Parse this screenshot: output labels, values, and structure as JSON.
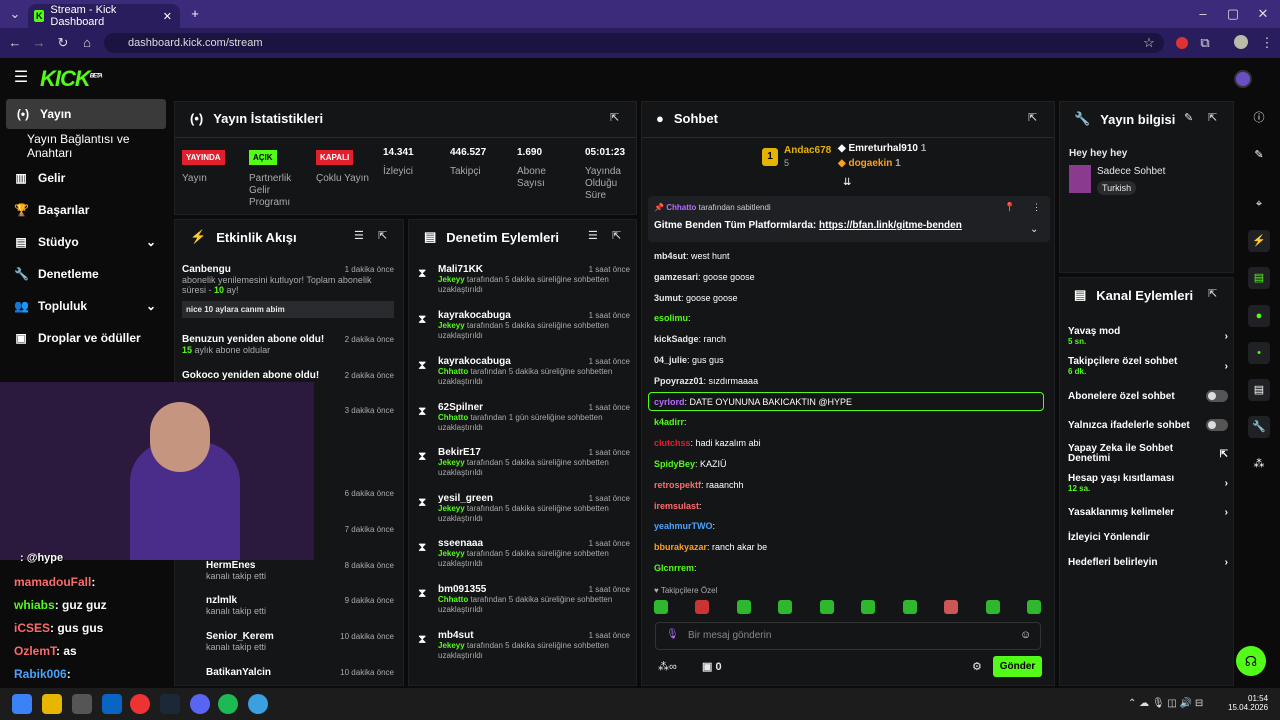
{
  "browser": {
    "tab_title": "Stream - Kick Dashboard",
    "url": "dashboard.kick.com/stream"
  },
  "header": {
    "logo": "KICK",
    "logo_sup": "BETA"
  },
  "nav": {
    "items": [
      {
        "label": "Yayın",
        "icon": "broadcast-icon"
      },
      {
        "label": "Yayın Bağlantısı ve Anahtarı"
      },
      {
        "label": "Gelir",
        "icon": "revenue-icon"
      },
      {
        "label": "Başarılar",
        "icon": "trophy-icon"
      },
      {
        "label": "Stüdyo",
        "icon": "studio-icon"
      },
      {
        "label": "Denetleme",
        "icon": "wrench-icon"
      },
      {
        "label": "Topluluk",
        "icon": "community-icon"
      },
      {
        "label": "Droplar ve ödüller",
        "icon": "gift-icon"
      }
    ]
  },
  "stats": {
    "title": "Yayın İstatistikleri",
    "tags": [
      {
        "text": "YAYINDA",
        "label": "Yayın",
        "color": "#e0202d"
      },
      {
        "text": "AÇIK",
        "label": "Partnerlik Gelir Programı",
        "color": "#53fc18"
      },
      {
        "text": "KAPALI",
        "label": "Çoklu Yayın",
        "color": "#e0202d"
      }
    ],
    "values": [
      {
        "value": "14.341",
        "label": "İzleyici"
      },
      {
        "value": "446.527",
        "label": "Takipçi"
      },
      {
        "value": "1.690",
        "label": "Abone Sayısı"
      },
      {
        "value": "05:01:23",
        "label": "Yayında Olduğu Süre"
      }
    ]
  },
  "activity": {
    "title": "Etkinlik Akışı",
    "items": [
      {
        "name": "Canbengu",
        "time": "1 dakika önce",
        "desc": "abonelik yenilemesini kutluyor! Toplam abonelik süresi - ",
        "months": "10",
        "suffix": " ay!",
        "msg": "nice 10 aylara canım abim"
      },
      {
        "name": "Benuzun yeniden abone oldu!",
        "time": "2 dakika önce",
        "months": "15",
        "desc": " aylık abone oldular"
      },
      {
        "name": "Gokoco yeniden abone oldu!",
        "time": "2 dakika önce"
      },
      {
        "name": "",
        "time": "3 dakika önce"
      },
      {
        "name": "e",
        "time": "3 dakika önce"
      },
      {
        "name": "du!",
        "time": "6 dakika önce"
      },
      {
        "name": "",
        "time": "7 dakika önce"
      },
      {
        "name": "HermEnes",
        "time": "8 dakika önce",
        "desc": "kanalı takip etti"
      },
      {
        "name": "nzlmlk",
        "time": "9 dakika önce",
        "desc": "kanalı takip etti"
      },
      {
        "name": "Senior_Kerem",
        "time": "10 dakika önce",
        "desc": "kanalı takip etti"
      },
      {
        "name": "BatikanYalcin",
        "time": "10 dakika önce"
      }
    ]
  },
  "moderation": {
    "title": "Denetim Eylemleri",
    "items": [
      {
        "name": "Mali71KK",
        "time": "1 saat önce",
        "by": "Jekeyy",
        "desc": " tarafından 5 dakika süreliğine sohbetten uzaklaştırıldı"
      },
      {
        "name": "kayrakocabuga",
        "time": "1 saat önce",
        "by": "Jekeyy",
        "desc": " tarafından 5 dakika süreliğine sohbetten uzaklaştırıldı"
      },
      {
        "name": "kayrakocabuga",
        "time": "1 saat önce",
        "by": "Chhatto",
        "desc": " tarafından 5 dakika süreliğine sohbetten uzaklaştırıldı"
      },
      {
        "name": "62Spilner",
        "time": "1 saat önce",
        "by": "Chhatto",
        "desc": " tarafından 1 gün süreliğine sohbetten uzaklaştırıldı"
      },
      {
        "name": "BekirE17",
        "time": "1 saat önce",
        "by": "Jekeyy",
        "desc": " tarafından 5 dakika süreliğine sohbetten uzaklaştırıldı"
      },
      {
        "name": "yesil_green",
        "time": "1 saat önce",
        "by": "Jekeyy",
        "desc": " tarafından 5 dakika süreliğine sohbetten uzaklaştırıldı"
      },
      {
        "name": "sseenaaa",
        "time": "1 saat önce",
        "by": "Jekeyy",
        "desc": " tarafından 5 dakika süreliğine sohbetten uzaklaştırıldı"
      },
      {
        "name": "bm091355",
        "time": "1 saat önce",
        "by": "Chhatto",
        "desc": " tarafından 5 dakika süreliğine sohbetten uzaklaştırıldı"
      },
      {
        "name": "mb4sut",
        "time": "1 saat önce",
        "by": "Jekeyy",
        "desc": " tarafından 5 dakika süreliğine sohbetten uzaklaştırıldı"
      }
    ]
  },
  "chat": {
    "title": "Sohbet",
    "top": [
      {
        "name": "Andac678",
        "count": "5",
        "rank": "1"
      },
      {
        "name": "Emreturhal910",
        "count": "1"
      },
      {
        "name": "dogaekin",
        "count": "1"
      }
    ],
    "pinned": {
      "by": "Chhatto",
      "label": "tarafından sabitlendi",
      "text": "Gitme Benden Tüm Platformlarda: ",
      "link": "https://bfan.link/gitme-benden"
    },
    "messages": [
      {
        "user": "mb4sut",
        "color": "#e8e8e8",
        "text": "west hunt"
      },
      {
        "user": "gamzesari",
        "color": "#e8e8e8",
        "text": "goose goose"
      },
      {
        "user": "3umut",
        "color": "#e8e8e8",
        "text": "goose goose"
      },
      {
        "user": "esolimu",
        "color": "#53fc18",
        "text": ""
      },
      {
        "user": "kickSadge",
        "color": "#e8e8e8",
        "text": "ranch"
      },
      {
        "user": "04_julie",
        "color": "#e8e8e8",
        "text": "gus gus"
      },
      {
        "user": "Ppoyrazz01",
        "color": "#e8e8e8",
        "text": "sızdırmaaaa"
      },
      {
        "user": "cyrlord",
        "color": "#b36cff",
        "text": "DATE OYUNUNA BAKICAKTIN @HYPE"
      },
      {
        "user": "k4adirr",
        "color": "#53fc18",
        "text": ""
      },
      {
        "user": "clutchss",
        "color": "#e0202d",
        "text": "hadi kazalım abi"
      },
      {
        "user": "SpidyBey",
        "color": "#53fc18",
        "text": "KAZIÜ"
      },
      {
        "user": "retrospektf",
        "color": "#ff6b6b",
        "text": "raaanchh"
      },
      {
        "user": "iremsulast",
        "color": "#ff6b6b",
        "text": ""
      },
      {
        "user": "yeahmurTWO",
        "color": "#4aa3ff",
        "text": ""
      },
      {
        "user": "bburakyazar",
        "color": "#ff9f1a",
        "text": "ranch akar be"
      },
      {
        "user": "Glcnrrem",
        "color": "#53fc18",
        "text": ""
      }
    ],
    "followers_only": "Takipçilere Özel",
    "input_placeholder": "Bir mesaj gönderin",
    "send": "Gönder",
    "kicks": "0"
  },
  "info": {
    "title": "Yayın bilgisi",
    "stream_title": "Hey hey hey",
    "category": "Sadece Sohbet",
    "tag": "Turkish"
  },
  "channel": {
    "title": "Kanal Eylemleri",
    "items": [
      {
        "label": "Yavaş mod",
        "sub": "5 sn."
      },
      {
        "label": "Takipçilere özel sohbet",
        "sub": "6 dk."
      },
      {
        "label": "Abonelere özel sohbet"
      },
      {
        "label": "Yalnızca ifadelerle sohbet"
      },
      {
        "label": "Yapay Zeka ile Sohbet Denetimi"
      },
      {
        "label": "Hesap yaşı kısıtlaması",
        "sub": "12 sa."
      },
      {
        "label": "Yasaklanmış kelimeler"
      },
      {
        "label": "İzleyici Yönlendir"
      },
      {
        "label": "Hedefleri belirleyin"
      }
    ]
  },
  "overlay_chat": [
    {
      "user": "mamadouFall",
      "color": "#ff6b6b",
      "text": ":"
    },
    {
      "user": "whiabs",
      "color": "#53fc18",
      "text": ": guz guz"
    },
    {
      "user": "iCSES",
      "color": "#ff6b6b",
      "text": ": gus gus"
    },
    {
      "user": "OzlemT",
      "color": "#ff6b6b",
      "text": ": as"
    },
    {
      "user": "Rabik006",
      "color": "#4aa3ff",
      "text": ":"
    }
  ],
  "overlay_top": "@hype",
  "clock": {
    "time": "01:54",
    "date": "15.04.2026"
  }
}
